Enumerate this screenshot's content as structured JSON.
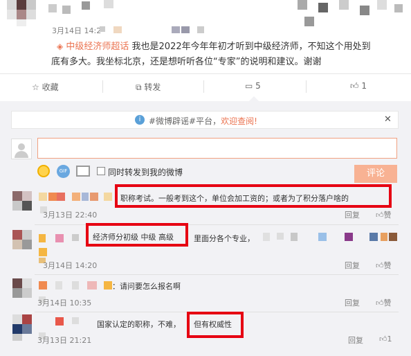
{
  "post": {
    "date": "3月14日 14:2",
    "topic": "中级经济师超话",
    "line1": "我也是2022年今年年初才听到中级经济师，不知这个用处到",
    "line2": "底有多大。我坐标北京，还是想听听各位“专家”的说明和建议。谢谢"
  },
  "actions": {
    "favorite": "收藏",
    "repost": "转发",
    "comment_count": "5",
    "like_count": "1"
  },
  "notice": {
    "prefix": "#微博辟谣#平台，",
    "link": "欢迎查阅!"
  },
  "composer": {
    "input_value": "",
    "sync_label": "同时转发到我的微博",
    "submit_label": "评论"
  },
  "comments": [
    {
      "text": "职称考试。一般考到这个，单位会加工资的；或者为了积分落户啥的",
      "date": "3月13日 22:40",
      "reply": "回复",
      "like": "赞",
      "like_count": ""
    },
    {
      "text_boxed": "经济师分初级 中级 高级",
      "text_rest": "里面分各个专业，",
      "date": "3月14日 14:20",
      "reply": "回复",
      "like": "赞",
      "like_count": ""
    },
    {
      "text": "：请问要怎么报名啊",
      "date": "3月14日 10:35",
      "reply": "回复",
      "like": "赞",
      "like_count": ""
    },
    {
      "text_pre": "国家认定的职称，不难，",
      "text_boxed": "但有权威性",
      "date": "3月13日 21:21",
      "reply": "回复",
      "like": "",
      "like_count": "1"
    }
  ],
  "colors": {
    "accent_orange": "#eb7350",
    "red_box": "#e60012",
    "panel_bg": "#f2f2f5"
  }
}
